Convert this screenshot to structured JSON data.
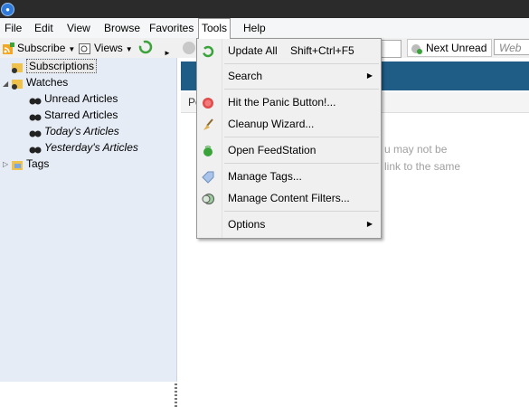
{
  "menubar": {
    "file": "File",
    "edit": "Edit",
    "view": "View",
    "browse": "Browse",
    "favorites": "Favorites",
    "tools": "Tools",
    "help": "Help"
  },
  "toolbar": {
    "subscribe": "Subscribe",
    "views": "Views",
    "next_unread": "Next Unread",
    "search_placeholder": "Web A"
  },
  "tree": {
    "subscriptions": "Subscriptions",
    "watches": "Watches",
    "unread": "Unread Articles",
    "starred": "Starred Articles",
    "today": "Today's Articles",
    "yesterday": "Yesterday's Articles",
    "tags": "Tags"
  },
  "main": {
    "subheader_fragment": "Po",
    "empty_line1": "u may not be",
    "empty_line2": "link to the same"
  },
  "tools_menu": {
    "update_all": "Update All",
    "update_all_shortcut": "Shift+Ctrl+F5",
    "search": "Search",
    "panic": "Hit the Panic Button!...",
    "cleanup": "Cleanup Wizard...",
    "feedstation": "Open FeedStation",
    "manage_tags": "Manage Tags...",
    "content_filters": "Manage Content Filters...",
    "options": "Options"
  },
  "icons": {
    "app": "feeddemon-app-icon",
    "subscribe": "rss-plus-icon",
    "views": "magnifier-icon",
    "refresh": "refresh-icon",
    "panic": "panic-red-icon",
    "cleanup": "broom-icon",
    "feedstation": "feedstation-icon",
    "tags": "tag-icon",
    "filters": "filter-icon",
    "watch": "binoculars-icon",
    "folder": "folder-icon"
  },
  "colors": {
    "banner": "#1f5d86",
    "tree_bg": "#e6ecf6",
    "accent_green": "#3aa33a"
  }
}
